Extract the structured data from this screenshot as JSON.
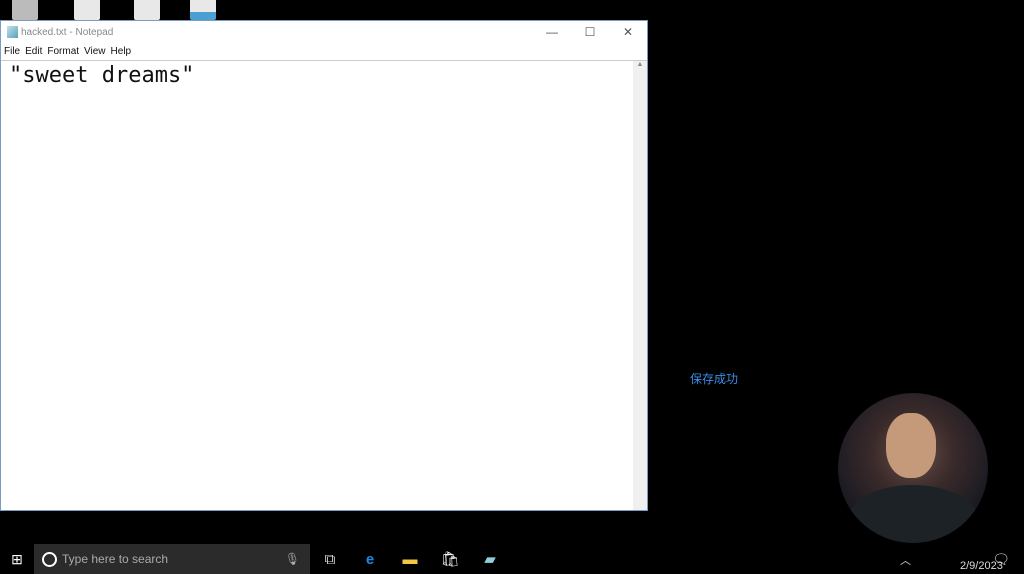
{
  "window": {
    "title": "hacked.txt - Notepad",
    "minimize": "—",
    "maximize": "☐",
    "close": "✕"
  },
  "menu": [
    "File",
    "Edit",
    "Format",
    "View",
    "Help"
  ],
  "editor": {
    "content": "\"sweet dreams\""
  },
  "toast": "保存成功",
  "taskbar": {
    "search_placeholder": "Type here to search",
    "date": "2/9/2023"
  }
}
